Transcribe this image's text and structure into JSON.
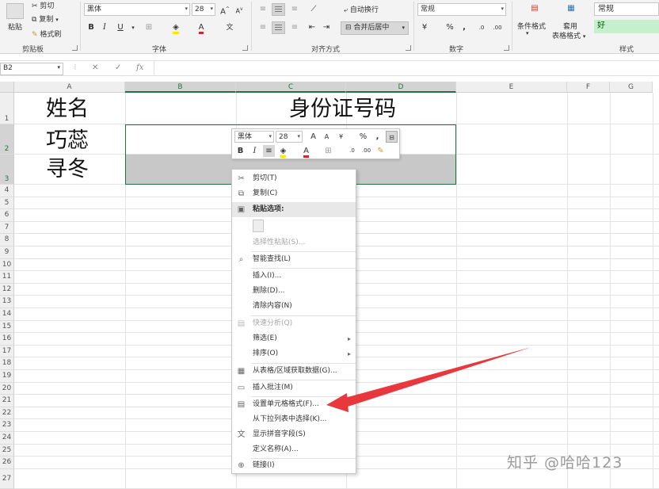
{
  "ribbon": {
    "clipboard": {
      "paste": "粘贴",
      "cut": "剪切",
      "copy": "复制",
      "format_painter": "格式刷",
      "group_label": "剪贴板"
    },
    "font": {
      "font_name": "黑体",
      "font_size": "28",
      "grow": "A",
      "shrink": "A",
      "bold": "B",
      "italic": "I",
      "underline": "U",
      "font_color_glyph": "A",
      "phonetic_glyph": "文",
      "group_label": "字体"
    },
    "alignment": {
      "wrap_text": "自动换行",
      "merge_center": "合并后居中",
      "group_label": "对齐方式"
    },
    "number": {
      "format": "常规",
      "percent": "%",
      "comma": ",",
      "group_label": "数字"
    },
    "styles": {
      "conditional_format": "条件格式",
      "table_format_1": "套用",
      "table_format_2": "表格格式",
      "style_normal": "常规",
      "style_good": "好",
      "group_label": "样式"
    }
  },
  "formula_bar": {
    "name_box": "B2",
    "cancel": "✕",
    "enter": "✓",
    "fx": "fx"
  },
  "sheet": {
    "columns": [
      "A",
      "B",
      "C",
      "D",
      "E",
      "F",
      "G"
    ],
    "rows": [
      "1",
      "2",
      "3",
      "4",
      "5",
      "6",
      "7",
      "8",
      "9",
      "10",
      "11",
      "12",
      "13",
      "14",
      "15",
      "16",
      "17",
      "18",
      "19",
      "20",
      "21",
      "22",
      "23",
      "24",
      "25",
      "26",
      "27"
    ],
    "cells": {
      "A1": "姓名",
      "B1": "身份证号码",
      "A2": "巧蕊",
      "A3": "寻冬"
    }
  },
  "mini_toolbar": {
    "font_name": "黑体",
    "font_size": "28",
    "grow": "A",
    "shrink": "A",
    "percent": "%",
    "comma": ",",
    "bold": "B",
    "italic": "I",
    "font_color": "A"
  },
  "context_menu": {
    "items": [
      {
        "label": "剪切(T)",
        "icon": "scissors-icon",
        "disabled": false
      },
      {
        "label": "复制(C)",
        "icon": "copy-icon",
        "disabled": false
      },
      {
        "label": "粘贴选项:",
        "icon": "paste-icon",
        "header": true
      },
      {
        "label": "选择性粘贴(S)...",
        "disabled": true
      },
      {
        "label": "智能查找(L)",
        "icon": "magnifier-icon",
        "disabled": false
      },
      {
        "label": "插入(I)...",
        "disabled": false
      },
      {
        "label": "删除(D)...",
        "disabled": false
      },
      {
        "label": "清除内容(N)",
        "disabled": false
      },
      {
        "label": "快速分析(Q)",
        "icon": "quick-analysis-icon",
        "disabled": true
      },
      {
        "label": "筛选(E)",
        "submenu": true,
        "disabled": false
      },
      {
        "label": "排序(O)",
        "submenu": true,
        "disabled": false
      },
      {
        "label": "从表格/区域获取数据(G)...",
        "icon": "table-icon",
        "disabled": false
      },
      {
        "label": "插入批注(M)",
        "icon": "comment-icon",
        "disabled": false
      },
      {
        "label": "设置单元格格式(F)...",
        "icon": "format-cells-icon",
        "disabled": false
      },
      {
        "label": "从下拉列表中选择(K)...",
        "disabled": false
      },
      {
        "label": "显示拼音字段(S)",
        "icon": "phonetic-icon",
        "disabled": false
      },
      {
        "label": "定义名称(A)...",
        "disabled": false
      },
      {
        "label": "链接(I)",
        "icon": "link-icon",
        "disabled": false
      }
    ]
  },
  "watermark": "知乎 @哈哈123",
  "colors": {
    "accent": "#217346",
    "arrow": "#e8383d",
    "selection_gray": "#c8c8c8"
  }
}
